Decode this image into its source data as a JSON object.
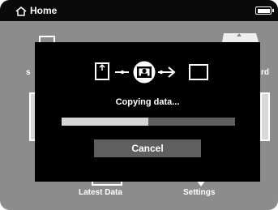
{
  "header": {
    "title": "Home",
    "home_icon": "home-icon",
    "battery_icon": "battery-icon",
    "battery_level": 1.0
  },
  "background_menu": {
    "items": [
      {
        "label": "Latest Data",
        "icon": "latest-data-icon"
      },
      {
        "label": "Settings",
        "icon": "settings-icon"
      }
    ],
    "partial_right_letters": "rd",
    "partial_left_letter": "s"
  },
  "dialog": {
    "message": "Copying data...",
    "progress": 0.5,
    "cancel_label": "Cancel",
    "flow_icons": [
      "memory-card-icon",
      "photo-transfer-icon",
      "storage-icon"
    ]
  },
  "colors": {
    "header_bg": "#0a0a0a",
    "screen_bg": "#8c8c8c",
    "dialog_bg": "#000000",
    "progress_fill": "#d6d6d6",
    "progress_track": "#5f5f5f",
    "button_bg": "#5f5f5f",
    "text": "#ffffff"
  }
}
